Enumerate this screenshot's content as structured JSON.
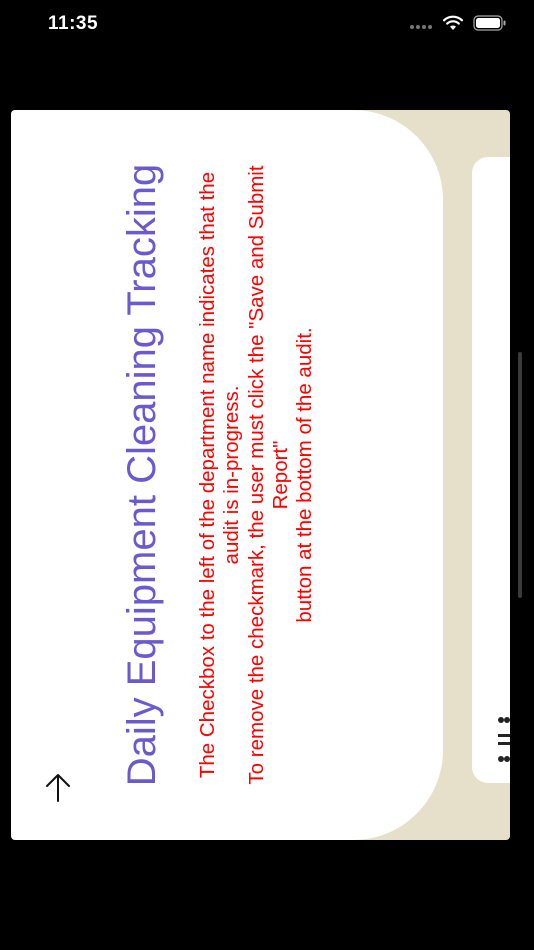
{
  "status_bar": {
    "time": "11:35",
    "icons": [
      "signal-dots-icon",
      "wifi-icon",
      "battery-icon"
    ]
  },
  "dialog": {
    "title": "Daily Equipment Cleaning Tracking",
    "message_lines": [
      "The Checkbox to the left of the department name indicates that the",
      "audit is in-progress.",
      "To remove the checkmark, the user must click the \"Save and Submit",
      "Report\"",
      "button at the bottom of the audit."
    ],
    "close_icon": "arrow-down-icon"
  },
  "colors": {
    "title": "#6a5acd",
    "message": "#ff0000",
    "back_card": "#e6e0cb",
    "background": "#000000"
  }
}
